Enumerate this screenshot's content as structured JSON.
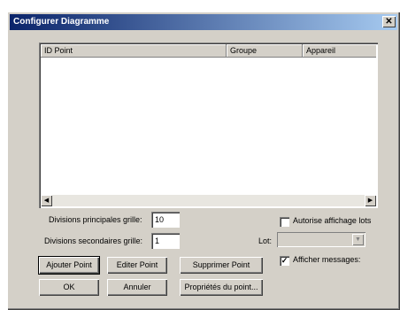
{
  "window": {
    "title": "Configurer Diagramme",
    "close_label": "✕"
  },
  "list": {
    "columns": [
      "ID Point",
      "Groupe",
      "Appareil"
    ],
    "rows": [],
    "scroll_left": "◀",
    "scroll_right": "▶"
  },
  "grid": {
    "major_label": "Divisions principales grille:",
    "major_value": "10",
    "minor_label": "Divisions secondaires grille:",
    "minor_value": "1"
  },
  "options": {
    "allow_lots_label": "Autorise affichage lots",
    "allow_lots_checked": false,
    "lot_label": "Lot:",
    "lot_value": "",
    "lot_dropdown_arrow": "▼",
    "show_messages_label": "Afficher messages:",
    "show_messages_checked": true,
    "check_mark": "✓"
  },
  "buttons": {
    "add_point": "Ajouter Point",
    "edit_point": "Editer Point",
    "delete_point": "Supprimer Point",
    "ok": "OK",
    "cancel": "Annuler",
    "point_properties": "Propriétés du point..."
  }
}
